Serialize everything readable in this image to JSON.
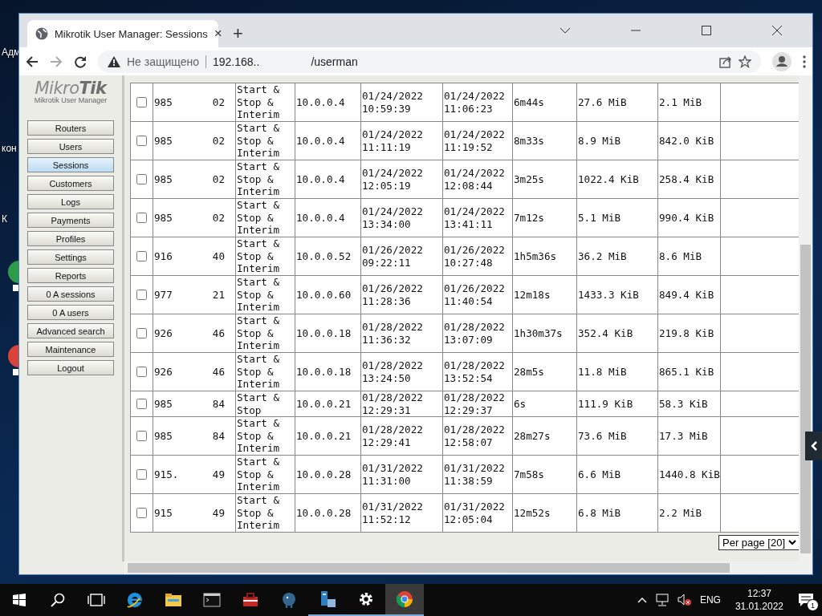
{
  "desktop": {
    "labels": [
      "Адм",
      "кон",
      "К"
    ]
  },
  "browser": {
    "tab_title": "Mikrotik User Manager: Sessions",
    "tab_close": "×",
    "new_tab": "+",
    "security": "Не защищено",
    "url_host": "192.168..",
    "url_path": "/userman"
  },
  "sidebar": {
    "logo": "Mikro**Tik**",
    "subtitle": "Mikrotik User Manager",
    "items": [
      {
        "label": "Routers",
        "selected": false
      },
      {
        "label": "Users",
        "selected": false
      },
      {
        "label": "Sessions",
        "selected": true
      },
      {
        "label": "Customers",
        "selected": false
      },
      {
        "label": "Logs",
        "selected": false
      },
      {
        "label": "Payments",
        "selected": false
      },
      {
        "label": "Profiles",
        "selected": false
      },
      {
        "label": "Settings",
        "selected": false
      },
      {
        "label": "Reports",
        "selected": false
      },
      {
        "label": "0 A sessions",
        "selected": false
      },
      {
        "label": "0 A users",
        "selected": false
      },
      {
        "label": "Advanced search",
        "selected": false
      },
      {
        "label": "Maintenance",
        "selected": false
      },
      {
        "label": "Logout",
        "selected": false
      }
    ]
  },
  "table": {
    "rows": [
      {
        "checked": false,
        "user_start": "985",
        "user_end": "02",
        "type": "Start & Stop & Interim",
        "ip": "10.0.0.4",
        "start": "01/24/2022 10:59:39",
        "end": "01/24/2022 11:06:23",
        "duration": "6m44s",
        "upload": "27.6 MiB",
        "download": "2.1 MiB"
      },
      {
        "checked": false,
        "user_start": "985",
        "user_end": "02",
        "type": "Start & Stop & Interim",
        "ip": "10.0.0.4",
        "start": "01/24/2022 11:11:19",
        "end": "01/24/2022 11:19:52",
        "duration": "8m33s",
        "upload": "8.9 MiB",
        "download": "842.0 KiB"
      },
      {
        "checked": false,
        "user_start": "985",
        "user_end": "02",
        "type": "Start & Stop & Interim",
        "ip": "10.0.0.4",
        "start": "01/24/2022 12:05:19",
        "end": "01/24/2022 12:08:44",
        "duration": "3m25s",
        "upload": "1022.4 KiB",
        "download": "258.4 KiB"
      },
      {
        "checked": false,
        "user_start": "985",
        "user_end": "02",
        "type": "Start & Stop & Interim",
        "ip": "10.0.0.4",
        "start": "01/24/2022 13:34:00",
        "end": "01/24/2022 13:41:11",
        "duration": "7m12s",
        "upload": "5.1 MiB",
        "download": "990.4 KiB"
      },
      {
        "checked": false,
        "user_start": "916",
        "user_end": "40",
        "type": "Start & Stop & Interim",
        "ip": "10.0.0.52",
        "start": "01/26/2022 09:22:11",
        "end": "01/26/2022 10:27:48",
        "duration": "1h5m36s",
        "upload": "36.2 MiB",
        "download": "8.6 MiB"
      },
      {
        "checked": false,
        "user_start": "977",
        "user_end": "21",
        "type": "Start & Stop & Interim",
        "ip": "10.0.0.60",
        "start": "01/26/2022 11:28:36",
        "end": "01/26/2022 11:40:54",
        "duration": "12m18s",
        "upload": "1433.3 KiB",
        "download": "849.4 KiB"
      },
      {
        "checked": false,
        "user_start": "926",
        "user_end": "46",
        "type": "Start & Stop & Interim",
        "ip": "10.0.0.18",
        "start": "01/28/2022 11:36:32",
        "end": "01/28/2022 13:07:09",
        "duration": "1h30m37s",
        "upload": "352.4 KiB",
        "download": "219.8 KiB"
      },
      {
        "checked": false,
        "user_start": "926",
        "user_end": "46",
        "type": "Start & Stop & Interim",
        "ip": "10.0.0.18",
        "start": "01/28/2022 13:24:50",
        "end": "01/28/2022 13:52:54",
        "duration": "28m5s",
        "upload": "11.8 MiB",
        "download": "865.1 KiB"
      },
      {
        "checked": false,
        "user_start": "985",
        "user_end": "84",
        "type": "Start & Stop",
        "ip": "10.0.0.21",
        "start": "01/28/2022 12:29:31",
        "end": "01/28/2022 12:29:37",
        "duration": "6s",
        "upload": "111.9 KiB",
        "download": "58.3 KiB"
      },
      {
        "checked": false,
        "user_start": "985",
        "user_end": "84",
        "type": "Start & Stop & Interim",
        "ip": "10.0.0.21",
        "start": "01/28/2022 12:29:41",
        "end": "01/28/2022 12:58:07",
        "duration": "28m27s",
        "upload": "73.6 MiB",
        "download": "17.3 MiB"
      },
      {
        "checked": false,
        "user_start": "915.",
        "user_end": "49",
        "type": "Start & Stop & Interim",
        "ip": "10.0.0.28",
        "start": "01/31/2022 11:31:00",
        "end": "01/31/2022 11:38:59",
        "duration": "7m58s",
        "upload": "6.6 MiB",
        "download": "1440.8 KiB"
      },
      {
        "checked": false,
        "user_start": "915",
        "user_end": "49",
        "type": "Start & Stop & Interim",
        "ip": "10.0.0.28",
        "start": "01/31/2022 11:52:12",
        "end": "01/31/2022 12:05:04",
        "duration": "12m52s",
        "upload": "6.8 MiB",
        "download": "2.2 MiB"
      }
    ]
  },
  "pager": {
    "per_page": "Per page [20]"
  },
  "taskbar": {
    "apps": [
      {
        "kind": "ie",
        "selected": false,
        "running": false
      },
      {
        "kind": "explorer",
        "selected": false,
        "running": false
      },
      {
        "kind": "cmd",
        "selected": false,
        "running": false
      },
      {
        "kind": "toolbox",
        "selected": false,
        "running": false
      },
      {
        "kind": "elephant",
        "selected": false,
        "running": false
      },
      {
        "kind": "server",
        "selected": false,
        "running": true
      },
      {
        "kind": "gear",
        "selected": false,
        "running": true
      },
      {
        "kind": "chrome",
        "selected": true,
        "running": true
      }
    ],
    "language": "ENG",
    "time": "12:37",
    "date": "31.01.2022",
    "notifications": "1"
  }
}
